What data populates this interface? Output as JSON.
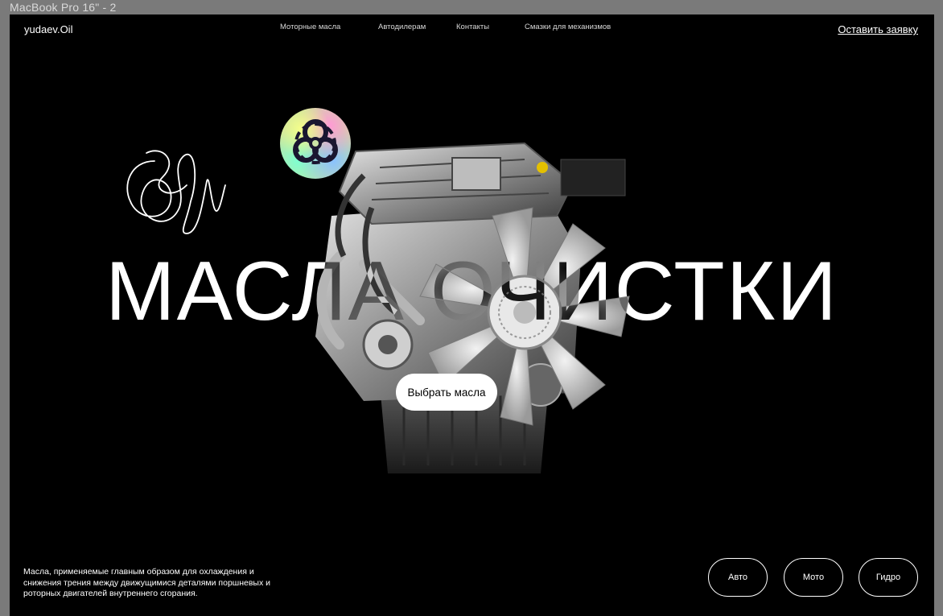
{
  "frame": {
    "label": "MacBook Pro 16\" - 2"
  },
  "header": {
    "logo": "yudaev.Oil",
    "nav": [
      "Моторные масла",
      "Автодилерам",
      "Контакты",
      "Смазки для механизмов"
    ],
    "cta": "Оставить заявку"
  },
  "hero": {
    "headline": "МАСЛА ОЧИСТКИ",
    "button": "Выбрать масла",
    "badge_icon": "biohazard-icon"
  },
  "footer": {
    "description": "Масла, применяемые главным образом для охлаждения и снижения трения между движущимися деталями поршневых и роторных двигателей внутреннего сгорания.",
    "categories": [
      "Авто",
      "Мото",
      "Гидро"
    ]
  },
  "colors": {
    "background": "#000000",
    "text": "#ffffff",
    "canvas": "#7a7a7a"
  }
}
